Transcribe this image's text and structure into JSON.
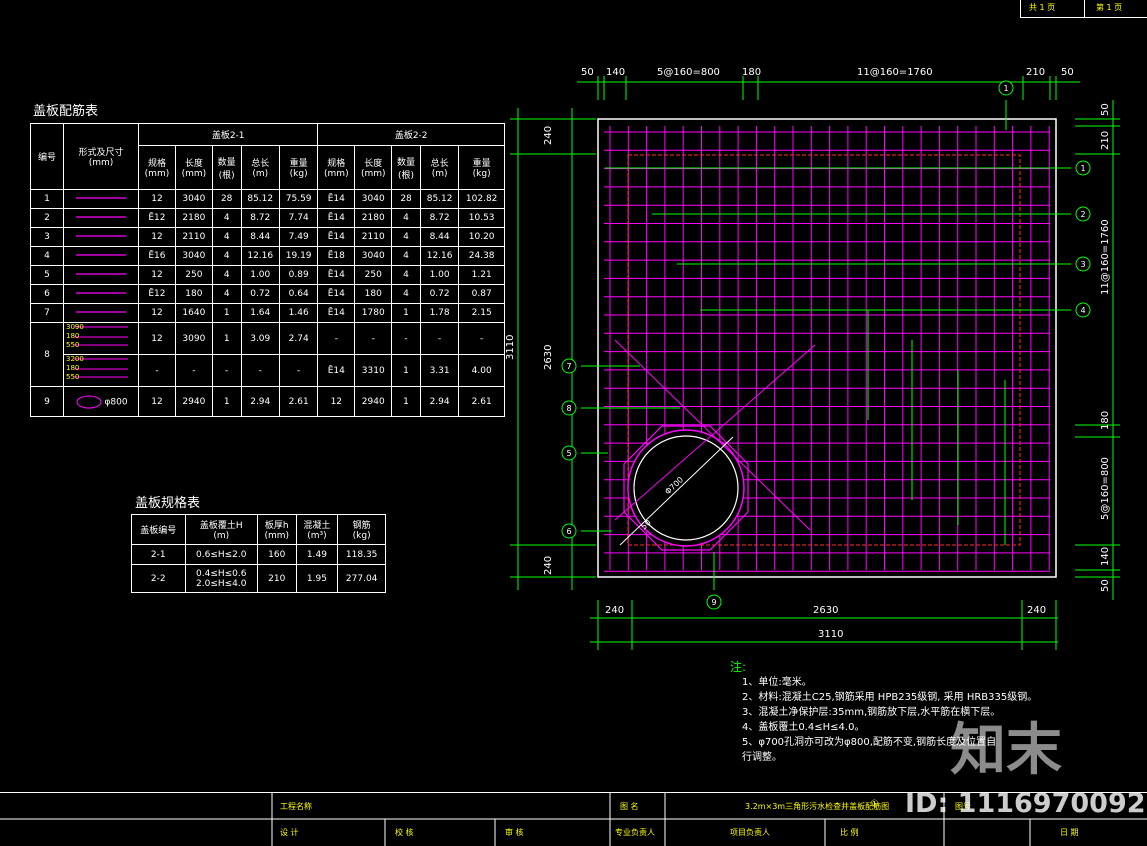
{
  "sheet_header": {
    "cell1": "共 1 页",
    "cell2": "第 1 页"
  },
  "rebar_table": {
    "title": "盖板配筋表",
    "col_id": "编号",
    "col_shape": "形式及尺寸",
    "col_shape_unit": "(mm)",
    "group1": "盖板2-1",
    "group2": "盖板2-2",
    "sub_headers": [
      [
        "规格",
        ""
      ],
      [
        "长度",
        "(mm)"
      ],
      [
        "数量",
        "(根)"
      ],
      [
        "总长",
        "(m)"
      ],
      [
        "重量",
        "(kg)"
      ]
    ],
    "sub_units": [
      "(mm)",
      "(根)",
      "(m)",
      "(kg)"
    ],
    "rows": [
      {
        "id": "1",
        "a": [
          "12",
          "3040",
          "28",
          "85.12",
          "75.59"
        ],
        "b": [
          "Ē14",
          "3040",
          "28",
          "85.12",
          "102.82"
        ]
      },
      {
        "id": "2",
        "a": [
          "Ē12",
          "2180",
          "4",
          "8.72",
          "7.74"
        ],
        "b": [
          "Ē14",
          "2180",
          "4",
          "8.72",
          "10.53"
        ]
      },
      {
        "id": "3",
        "a": [
          "12",
          "2110",
          "4",
          "8.44",
          "7.49"
        ],
        "b": [
          "Ē14",
          "2110",
          "4",
          "8.44",
          "10.20"
        ]
      },
      {
        "id": "4",
        "a": [
          "Ē16",
          "3040",
          "4",
          "12.16",
          "19.19"
        ],
        "b": [
          "Ē18",
          "3040",
          "4",
          "12.16",
          "24.38"
        ]
      },
      {
        "id": "5",
        "a": [
          "12",
          "250",
          "4",
          "1.00",
          "0.89"
        ],
        "b": [
          "Ē14",
          "250",
          "4",
          "1.00",
          "1.21"
        ]
      },
      {
        "id": "6",
        "a": [
          "Ē12",
          "180",
          "4",
          "0.72",
          "0.64"
        ],
        "b": [
          "Ē14",
          "180",
          "4",
          "0.72",
          "0.87"
        ]
      },
      {
        "id": "7",
        "a": [
          "12",
          "1640",
          "1",
          "1.64",
          "1.46"
        ],
        "b": [
          "Ē14",
          "1780",
          "1",
          "1.78",
          "2.15"
        ]
      },
      {
        "id": "8",
        "a": [
          "12",
          "3090",
          "1",
          "3.09",
          "2.74"
        ],
        "b": [
          "-",
          "-",
          "-",
          "-",
          "-"
        ]
      },
      {
        "id": "",
        "a": [
          "-",
          "-",
          "-",
          "-",
          "-"
        ],
        "b": [
          "Ē14",
          "3310",
          "1",
          "3.31",
          "4.00"
        ]
      },
      {
        "id": "9",
        "a": [
          "12",
          "2940",
          "1",
          "2.94",
          "2.61"
        ],
        "b": [
          "12",
          "2940",
          "1",
          "2.94",
          "2.61"
        ]
      }
    ],
    "shape8_dims_a": [
      "3090",
      "180",
      "550"
    ],
    "shape8_dims_b": [
      "3200",
      "180",
      "550"
    ],
    "shape9_dim": "φ800"
  },
  "spec_table": {
    "title": "盖板规格表",
    "headers": [
      [
        "盖板编号",
        ""
      ],
      [
        "盖板覆土H",
        "(m)"
      ],
      [
        "板厚h",
        "(mm)"
      ],
      [
        "混凝土",
        "(m³)"
      ],
      [
        "钢筋",
        "(kg)"
      ]
    ],
    "rows": [
      {
        "id": "2-1",
        "h_lines": [
          "0.6≤H≤2.0"
        ],
        "t": "160",
        "c": "1.49",
        "s": "118.35"
      },
      {
        "id": "2-2",
        "h_lines": [
          "0.4≤H≤0.6",
          "2.0≤H≤4.0"
        ],
        "t": "210",
        "c": "1.95",
        "s": "277.04"
      }
    ]
  },
  "plan": {
    "top_dims": [
      "50",
      "140",
      "5@160=800",
      "180",
      "11@160=1760",
      "210",
      "50"
    ],
    "left_dims": [
      "240",
      "2630",
      "240"
    ],
    "left_total": "3110",
    "right_dims": [
      "50",
      "210",
      "11@160=1760",
      "180",
      "5@160=800",
      "140",
      "50"
    ],
    "bottom_dims": [
      "240",
      "2630",
      "240"
    ],
    "bottom_total": "3110",
    "diam_label": "Φ700",
    "r_label": "50",
    "markers": [
      "1",
      "1",
      "2",
      "3",
      "4",
      "7",
      "8",
      "5",
      "6",
      "9"
    ]
  },
  "notes": {
    "heading": "注:",
    "items": [
      "1、单位:毫米。",
      "2、材料:混凝土C25,钢筋采用  HPB235级钢, 采用  HRB335级钢。",
      "3、混凝土净保护层:35mm,钢筋放下层,水平筋在横下层。",
      "4、盖板覆土0.4≤H≤4.0。",
      "5、φ700孔洞亦可改为φ800,配筋不变,钢筋长度及位置自",
      "   行调整。"
    ]
  },
  "title_block": {
    "project_label": "工程名称",
    "drawing_label": "图   名",
    "drawing_name": "3.2m×3m三角形污水检查井盖板配筋图",
    "drawing_no": "①",
    "no_label": "图号",
    "design": "设   计",
    "check": "校   核",
    "review": "审   核",
    "chief": "专业负责人",
    "pm": "项目负责人",
    "scale": "比   例",
    "date": "日 期"
  },
  "watermarks": {
    "logo": "知末",
    "id": "ID: 1116970092"
  },
  "colors": {
    "rebar": "#ff00ff",
    "dim": "#00ff00",
    "leader": "#00ff00",
    "outline": "#ffffff"
  }
}
